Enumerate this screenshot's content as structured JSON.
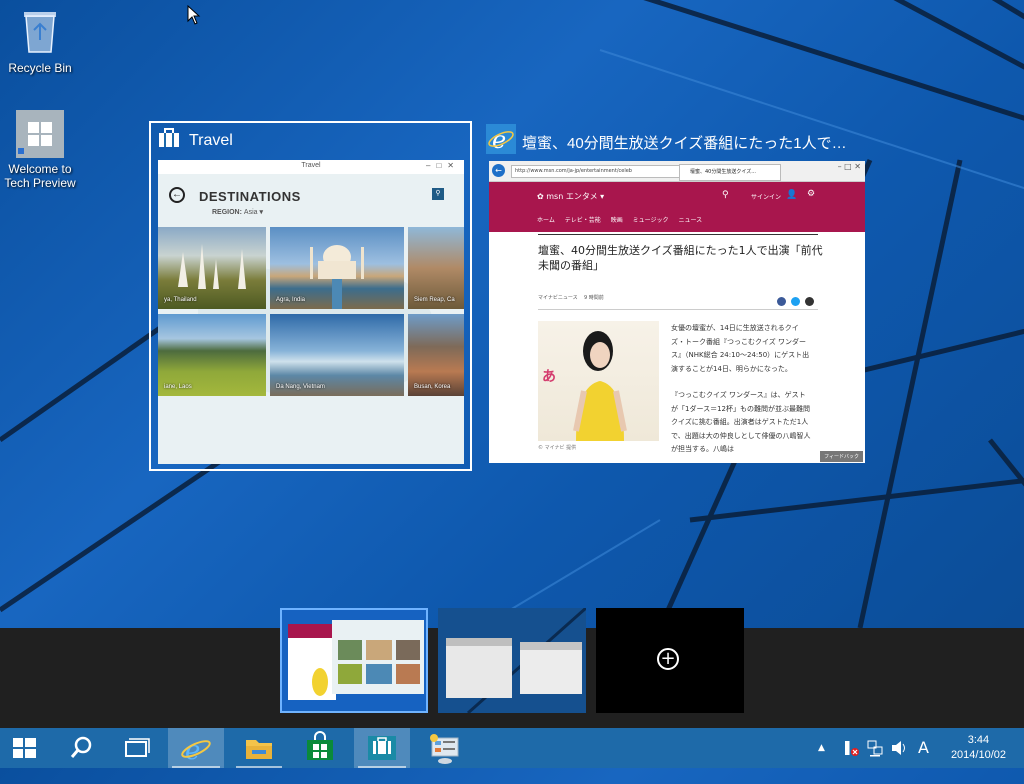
{
  "desktop": {
    "icons": [
      {
        "label": "Recycle Bin",
        "icon": "recycle-bin-icon"
      },
      {
        "label": "Welcome to Tech Preview",
        "icon": "windows-logo-icon"
      }
    ]
  },
  "task_view": {
    "windows": [
      {
        "title": "Travel",
        "icon": "travel-suitcase-icon",
        "app": {
          "titlebar": "Travel",
          "heading": "DESTINATIONS",
          "region_label": "REGION:",
          "region_value": "Asia",
          "tiles": [
            {
              "caption": "ya, Thailand"
            },
            {
              "caption": "Agra, India"
            },
            {
              "caption": "Siem Reap, Ca"
            },
            {
              "caption": "iane, Laos"
            },
            {
              "caption": "Da Nang, Vietnam"
            },
            {
              "caption": "Busan, Korea"
            }
          ]
        }
      },
      {
        "title": "壇蜜、40分間生放送クイズ番組にたった1人で…",
        "icon": "internet-explorer-icon",
        "browser": {
          "address": "http://www.msn.com/ja-jp/entertainment/celeb",
          "tab_title": "壇蜜、40分間生放送クイズ...",
          "site_name": "msn エンタメ",
          "signin": "サインイン",
          "nav": [
            "ホーム",
            "テレビ・芸能",
            "映画",
            "ミュージック",
            "ニュース"
          ],
          "article_title": "壇蜜、40分間生放送クイズ番組にたった1人で出演「前代未聞の番組」",
          "source": "マイナビニュース",
          "time_ago": "9 時間前",
          "photo_caption": "© マイナビ 提供",
          "body_1": "女優の壇蜜が、14日に生放送されるクイズ・トーク番組『つっこむクイズ ワンダース』（NHK総合 24:10〜24:50）にゲスト出演することが14日、明らかになった。",
          "body_2": "『つっこむクイズ ワンダース』は、ゲストが「1ダース＝12杯」もの難問が並ぶ最難問クイズに挑む番組。出演者はゲストただ1人で、出題は大の仲良しとして俳優の八嶋智人が担当する。八嶋は",
          "feedback": "フィードバック"
        }
      }
    ],
    "desktops": [
      {
        "name": "desktop-1"
      },
      {
        "name": "desktop-2"
      }
    ],
    "add_desktop_icon": "plus-circle-icon"
  },
  "taskbar": {
    "buttons": [
      {
        "icon": "windows-start-icon"
      },
      {
        "icon": "search-icon"
      },
      {
        "icon": "task-view-icon"
      },
      {
        "icon": "internet-explorer-icon"
      },
      {
        "icon": "file-explorer-icon"
      },
      {
        "icon": "store-icon"
      },
      {
        "icon": "travel-suitcase-icon"
      },
      {
        "icon": "control-panel-icon"
      }
    ],
    "tray": {
      "ime": "A",
      "time": "3:44",
      "date": "2014/10/02"
    }
  },
  "colors": {
    "taskbar": "#1e6aa9",
    "strip": "#202020",
    "msn_accent": "#a8164d",
    "selection_border": "#ffffff"
  }
}
